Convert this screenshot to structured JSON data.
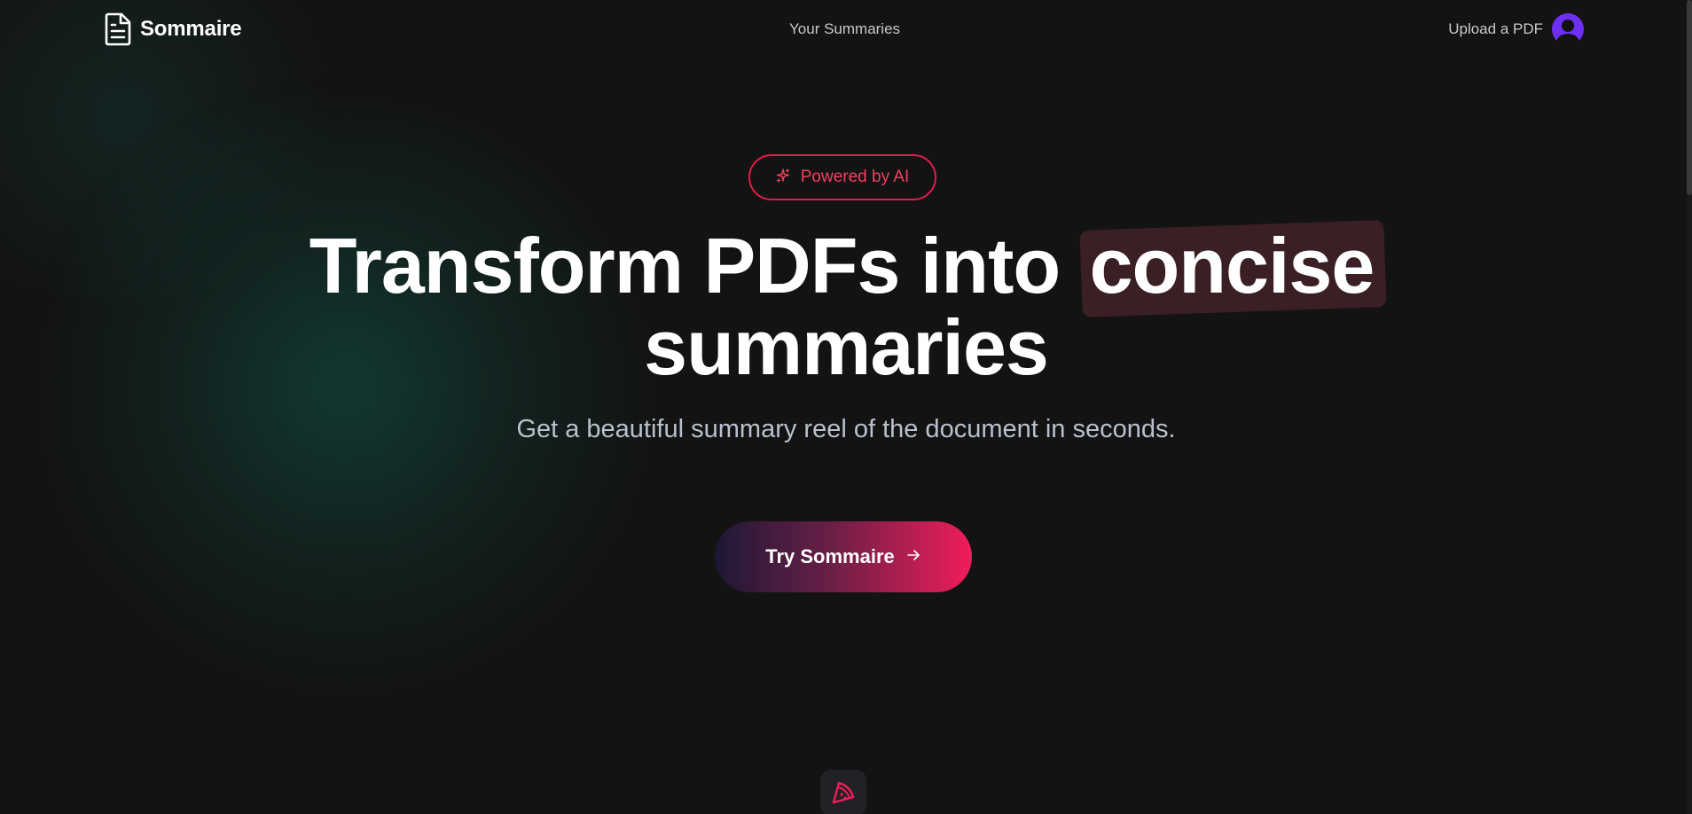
{
  "nav": {
    "brand_name": "Sommaire",
    "brand_icon": "document-icon",
    "center_link": "Your Summaries",
    "upload_link": "Upload a PDF",
    "avatar_icon": "user-avatar-icon",
    "avatar_color": "#6d2ff2"
  },
  "hero": {
    "badge_icon": "sparkles-icon",
    "badge_label": "Powered by AI",
    "headline_part1": "Transform PDFs into",
    "headline_highlight": "concise",
    "headline_part2": "summaries",
    "subtitle": "Get a beautiful summary reel of the document in seconds.",
    "cta_label": "Try Sommaire",
    "cta_icon": "arrow-right-icon"
  },
  "colors": {
    "accent": "#e11d48",
    "accent_bright": "#f01d5a",
    "background": "#131313"
  },
  "bottom_icon": "pizza-slice-icon"
}
